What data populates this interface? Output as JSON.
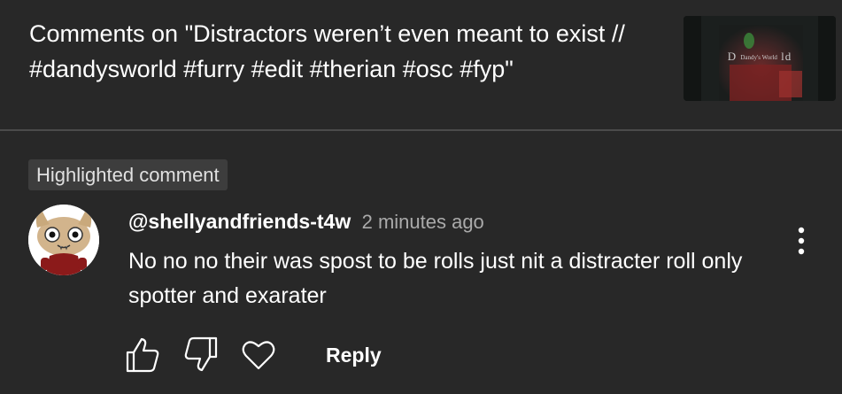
{
  "header": {
    "title": "Comments on \"Distractors weren’t even meant to exist // #dandysworld #furry #edit #therian #osc #fyp\"",
    "thumbnail_text_left": "D",
    "thumbnail_text_mid": "Dandy's World",
    "thumbnail_text_right": "ld"
  },
  "comment": {
    "badge": "Highlighted comment",
    "author": "@shellyandfriends-t4w",
    "time": "2 minutes ago",
    "text": "No no no their was spost to be rolls just nit a distracter roll only spotter and exarater"
  },
  "actions": {
    "like_icon": "thumbs-up-icon",
    "dislike_icon": "thumbs-down-icon",
    "heart_icon": "heart-icon",
    "reply_label": "Reply"
  },
  "colors": {
    "background": "#282828",
    "badge_bg": "#3d3d3d",
    "secondary_text": "#aaaaaa",
    "divider": "#4b4b4b"
  }
}
